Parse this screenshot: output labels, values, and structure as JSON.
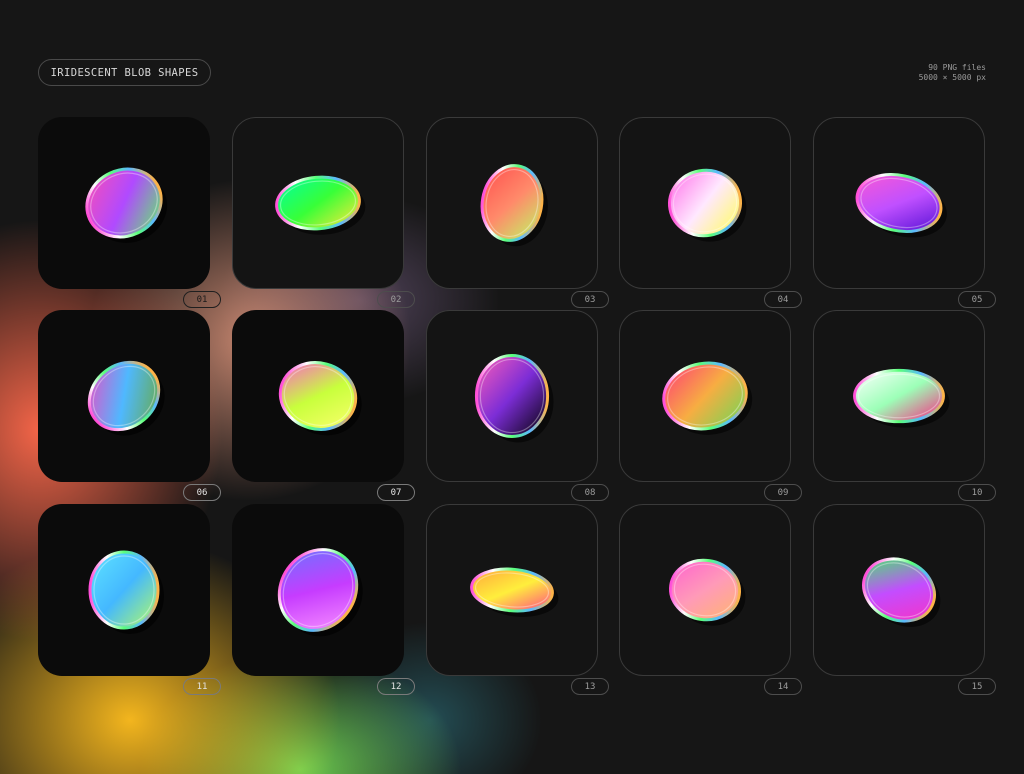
{
  "header": {
    "title": "IRIDESCENT BLOB SHAPES",
    "meta_line1": "90 PNG files",
    "meta_line2": "5000 × 5000 px"
  },
  "colors": {
    "background": "#161616",
    "tile": "#0b0b0b",
    "outline": "#3a3a3a"
  },
  "items": [
    {
      "number": "01",
      "gradient": [
        "#ff4fb0",
        "#b04aff",
        "#58ff5a"
      ]
    },
    {
      "number": "02",
      "gradient": [
        "#00ffa0",
        "#38ff38",
        "#ffe83a"
      ]
    },
    {
      "number": "03",
      "gradient": [
        "#ff4e4e",
        "#ff8a6a",
        "#bdfc64"
      ]
    },
    {
      "number": "04",
      "gradient": [
        "#ff6ae8",
        "#ffe8ff",
        "#ffff52"
      ]
    },
    {
      "number": "05",
      "gradient": [
        "#ff5ad0",
        "#c050ff",
        "#4a0ad0"
      ]
    },
    {
      "number": "06",
      "gradient": [
        "#ff3fbf",
        "#4fb8ff",
        "#6ca82a"
      ]
    },
    {
      "number": "07",
      "gradient": [
        "#ff59d4",
        "#c8ff3c",
        "#ffff70"
      ]
    },
    {
      "number": "08",
      "gradient": [
        "#ff5fb8",
        "#7c2dd6",
        "#000000"
      ]
    },
    {
      "number": "09",
      "gradient": [
        "#ff3a78",
        "#f7ad42",
        "#69d957"
      ]
    },
    {
      "number": "10",
      "gradient": [
        "#ffffff",
        "#9cffb7",
        "#ff2080"
      ]
    },
    {
      "number": "11",
      "gradient": [
        "#5fe4ff",
        "#44b8ff",
        "#b8ff5e"
      ]
    },
    {
      "number": "12",
      "gradient": [
        "#5f7cff",
        "#c63cff",
        "#ff9cff"
      ]
    },
    {
      "number": "13",
      "gradient": [
        "#ffa13b",
        "#ffee3c",
        "#ff3c8c"
      ]
    },
    {
      "number": "14",
      "gradient": [
        "#ff5fd0",
        "#ff9ab8",
        "#ffb76a"
      ]
    },
    {
      "number": "15",
      "gradient": [
        "#35ff58",
        "#c34dff",
        "#ff2ebc"
      ]
    }
  ]
}
